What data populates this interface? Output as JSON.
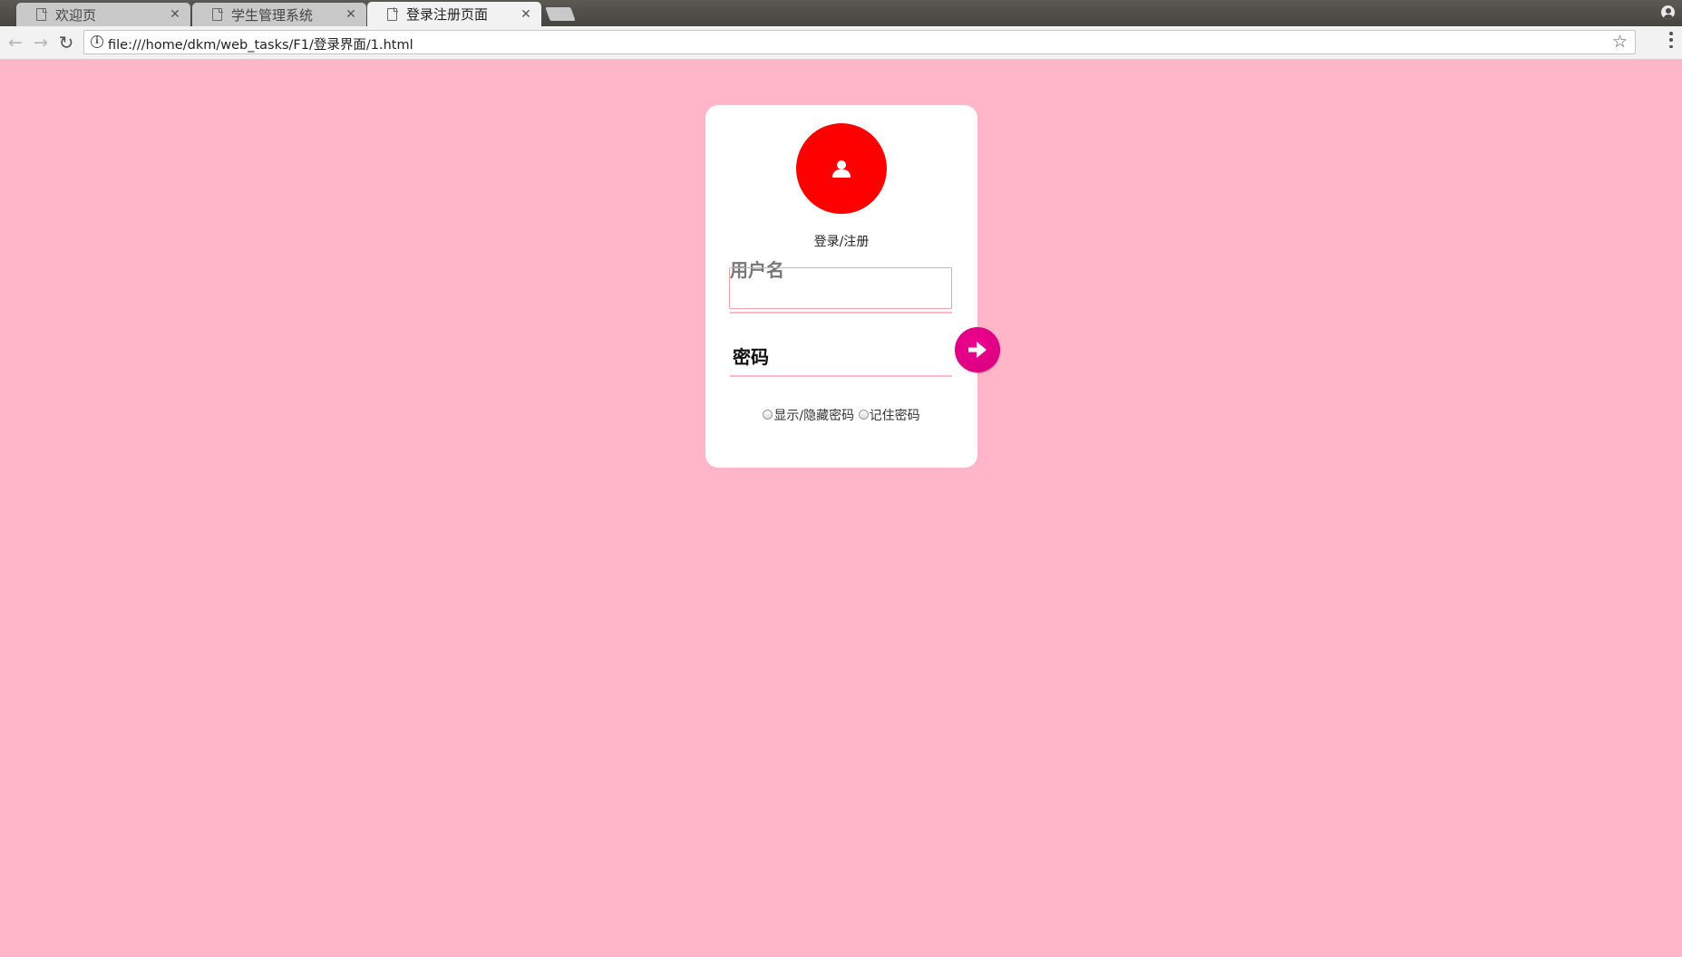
{
  "browser": {
    "tabs": [
      {
        "title": "欢迎页",
        "active": false
      },
      {
        "title": "学生管理系统",
        "active": false
      },
      {
        "title": "登录注册页面",
        "active": true
      }
    ],
    "url": "file:///home/dkm/web_tasks/F1/登录界面/1.html",
    "icons": {
      "back": "arrow-left-icon",
      "forward": "arrow-right-icon",
      "reload": "reload-icon",
      "info": "info-icon",
      "bookmark": "star-icon",
      "menu": "kebab-menu-icon",
      "profile": "profile-icon"
    }
  },
  "page": {
    "background_color": "#ffb6c8",
    "card": {
      "title": "登录/注册",
      "avatar_color": "#ff0000",
      "username_label": "用户名",
      "username_value": "",
      "password_label": "密码",
      "submit_color": "#e8008a",
      "options": [
        {
          "label": "显示/隐藏密码",
          "checked": false
        },
        {
          "label": "记住密码",
          "checked": false
        }
      ]
    }
  }
}
